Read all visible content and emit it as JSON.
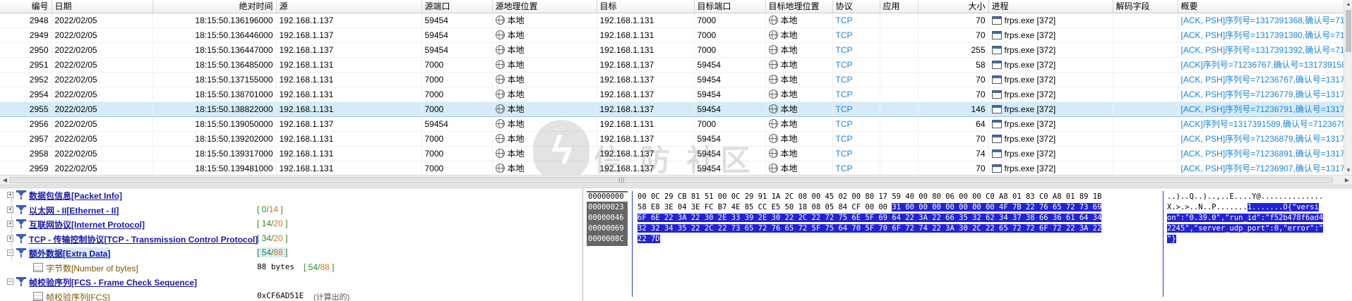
{
  "packet_list": {
    "columns": [
      "编号",
      "日期",
      "绝对时间",
      "源",
      "源端口",
      "源地理位置",
      "目标",
      "目标端口",
      "目标地理位置",
      "协议",
      "应用",
      "大小",
      "进程",
      "解码字段",
      "概要"
    ],
    "rows": [
      {
        "no": "2948",
        "date": "2022/02/05",
        "time": "18:15:50.136196000",
        "src": "192.168.1.137",
        "sport": "59454",
        "sgeo": "本地",
        "dst": "192.168.1.131",
        "dport": "7000",
        "dgeo": "本地",
        "proto": "TCP",
        "app": "",
        "size": "70",
        "proc": "frps.exe [372]",
        "decode": "",
        "summary": "[ACK, PSH]序列号=1317391368,确认号=71236"
      },
      {
        "no": "2949",
        "date": "2022/02/05",
        "time": "18:15:50.136446000",
        "src": "192.168.1.137",
        "sport": "59454",
        "sgeo": "本地",
        "dst": "192.168.1.131",
        "dport": "7000",
        "dgeo": "本地",
        "proto": "TCP",
        "app": "",
        "size": "70",
        "proc": "frps.exe [372]",
        "decode": "",
        "summary": "[ACK, PSH]序列号=1317391380,确认号=71236"
      },
      {
        "no": "2950",
        "date": "2022/02/05",
        "time": "18:15:50.136447000",
        "src": "192.168.1.137",
        "sport": "59454",
        "sgeo": "本地",
        "dst": "192.168.1.131",
        "dport": "7000",
        "dgeo": "本地",
        "proto": "TCP",
        "app": "",
        "size": "255",
        "proc": "frps.exe [372]",
        "decode": "",
        "summary": "[ACK, PSH]序列号=1317391392,确认号=71236"
      },
      {
        "no": "2951",
        "date": "2022/02/05",
        "time": "18:15:50.136485000",
        "src": "192.168.1.131",
        "sport": "7000",
        "sgeo": "本地",
        "dst": "192.168.1.137",
        "dport": "59454",
        "dgeo": "本地",
        "proto": "TCP",
        "app": "",
        "size": "58",
        "proc": "frps.exe [372]",
        "decode": "",
        "summary": "[ACK]序列号=71236767,确认号=1317391589"
      },
      {
        "no": "2952",
        "date": "2022/02/05",
        "time": "18:15:50.137155000",
        "src": "192.168.1.131",
        "sport": "7000",
        "sgeo": "本地",
        "dst": "192.168.1.137",
        "dport": "59454",
        "dgeo": "本地",
        "proto": "TCP",
        "app": "",
        "size": "70",
        "proc": "frps.exe [372]",
        "decode": "",
        "summary": "[ACK, PSH]序列号=71236767,确认号=131739"
      },
      {
        "no": "2954",
        "date": "2022/02/05",
        "time": "18:15:50.138701000",
        "src": "192.168.1.131",
        "sport": "7000",
        "sgeo": "本地",
        "dst": "192.168.1.137",
        "dport": "59454",
        "dgeo": "本地",
        "proto": "TCP",
        "app": "",
        "size": "70",
        "proc": "frps.exe [372]",
        "decode": "",
        "summary": "[ACK, PSH]序列号=71236779,确认号=131739"
      },
      {
        "no": "2955",
        "date": "2022/02/05",
        "time": "18:15:50.138822000",
        "src": "192.168.1.131",
        "sport": "7000",
        "sgeo": "本地",
        "dst": "192.168.1.137",
        "dport": "59454",
        "dgeo": "本地",
        "proto": "TCP",
        "app": "",
        "size": "146",
        "proc": "frps.exe [372]",
        "decode": "",
        "summary": "[ACK, PSH]序列号=71236791,确认号=131739",
        "selected": true
      },
      {
        "no": "2956",
        "date": "2022/02/05",
        "time": "18:15:50.139050000",
        "src": "192.168.1.137",
        "sport": "59454",
        "sgeo": "本地",
        "dst": "192.168.1.131",
        "dport": "7000",
        "dgeo": "本地",
        "proto": "TCP",
        "app": "",
        "size": "64",
        "proc": "frps.exe [372]",
        "decode": "",
        "summary": "[ACK]序列号=1317391589,确认号=71236791"
      },
      {
        "no": "2957",
        "date": "2022/02/05",
        "time": "18:15:50.139202000",
        "src": "192.168.1.131",
        "sport": "7000",
        "sgeo": "本地",
        "dst": "192.168.1.137",
        "dport": "59454",
        "dgeo": "本地",
        "proto": "TCP",
        "app": "",
        "size": "70",
        "proc": "frps.exe [372]",
        "decode": "",
        "summary": "[ACK, PSH]序列号=71236879,确认号=131739"
      },
      {
        "no": "2958",
        "date": "2022/02/05",
        "time": "18:15:50.139317000",
        "src": "192.168.1.131",
        "sport": "7000",
        "sgeo": "本地",
        "dst": "192.168.1.137",
        "dport": "59454",
        "dgeo": "本地",
        "proto": "TCP",
        "app": "",
        "size": "74",
        "proc": "frps.exe [372]",
        "decode": "",
        "summary": "[ACK, PSH]序列号=71236891,确认号=131739"
      },
      {
        "no": "2959",
        "date": "2022/02/05",
        "time": "18:15:50.139481000",
        "src": "192.168.1.131",
        "sport": "7000",
        "sgeo": "本地",
        "dst": "192.168.1.137",
        "dport": "59454",
        "dgeo": "本地",
        "proto": "TCP",
        "app": "",
        "size": "70",
        "proc": "frps.exe [372]",
        "decode": "",
        "summary": "[ACK, PSH]序列号=71236907,确认号=131739"
      }
    ]
  },
  "scrollbar": {
    "grip": "|||"
  },
  "watermark": {
    "text": "信 防 社区"
  },
  "detail_tree": [
    {
      "label": "数据包信息[Packet Info]",
      "range": "",
      "expander": "+",
      "icon": "funnel-icon"
    },
    {
      "label": "以太网 - II[Ethernet - II]",
      "range_a": "0",
      "range_b": "14",
      "expander": "+",
      "icon": "funnel-icon"
    },
    {
      "label": "互联网协议[Internet Protocol]",
      "range_a": "14",
      "range_b": "20",
      "expander": "+",
      "icon": "funnel-icon"
    },
    {
      "label": "TCP - 传输控制协议[TCP - Transmission Control Protocol]",
      "range_a": "34",
      "range_b": "20",
      "expander": "+",
      "icon": "funnel-icon"
    },
    {
      "label": "额外数据[Extra Data]",
      "range_a": "54",
      "range_b": "88",
      "expander": "−",
      "icon": "funnel-icon",
      "highlight": true
    },
    {
      "label": "字节数[Number of bytes]",
      "value": "88 bytes",
      "range_a": "54",
      "range_b": "88",
      "icon": "field-icon",
      "child": true
    },
    {
      "label": "帧校验序列[FCS - Frame Check Sequence]",
      "range": "",
      "expander": "−",
      "icon": "funnel-icon"
    },
    {
      "label": "帧校验序列[FCS]",
      "value": "0xCF6AD51E",
      "note": "(计算出的)",
      "icon": "field-icon",
      "child": true
    }
  ],
  "hex_dump": {
    "offsets": [
      "00000000",
      "00000023",
      "00000046",
      "00000069",
      "0000008C"
    ],
    "lines": [
      {
        "plain": "00 0C 29 CB 81 51 00 0C 29 91 1A 2C 08 00 45 02 00 80 17 59 40 00 80 06 00 00 C0 A8 01 83 C0 A8 01 89 1B",
        "sel": ""
      },
      {
        "plain": "58 E8 3E 04 3E FC B7 4E 85 CC E5 50 18 08 05 84 CF 00 00 ",
        "sel": "31 00 00 00 00 00 00 00 4F 7B 22 76 65 72 73 69"
      },
      {
        "plain": "",
        "sel": "6F 6E 22 3A 22 30 2E 33 39 2E 30 22 2C 22 72 75 6E 5F 69 64 22 3A 22 66 35 32 62 34 37 38 66 36 61 64 34"
      },
      {
        "plain": "",
        "sel": "32 32 34 35 22 2C 22 73 65 72 76 65 72 5F 75 64 70 5F 70 6F 72 74 22 3A 30 2C 22 65 72 72 6F 72 22 3A 22"
      },
      {
        "plain": "",
        "sel": "22 7D"
      }
    ],
    "ascii": [
      {
        "plain": "..)..Q..)..,..E....Y@..............",
        "sel": ""
      },
      {
        "plain": "X.>.>..N..P.......",
        "sel": "1.......O{\"versi"
      },
      {
        "plain": "",
        "sel": "on\":\"0.39.0\",\"run_id\":\"f52b478f6ad4"
      },
      {
        "plain": "",
        "sel": "2245\",\"server_udp_port\":0,\"error\":\""
      },
      {
        "plain": "",
        "sel": "\"}"
      }
    ]
  }
}
